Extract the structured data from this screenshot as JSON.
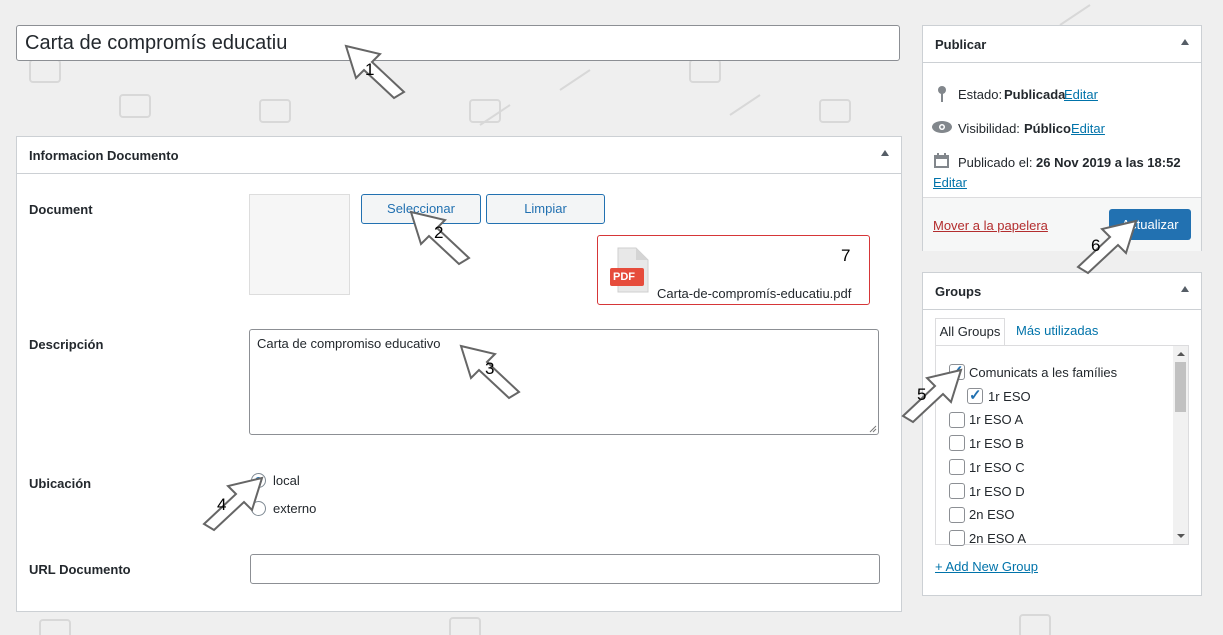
{
  "post_title": "Carta de compromís educatiu",
  "info_box": {
    "title": "Informacion Documento",
    "document_label": "Document",
    "select_button": "Seleccionar",
    "clear_button": "Limpiar",
    "file_badge": "PDF",
    "file_name": "Carta-de-compromís-educatiu.pdf",
    "description_label": "Descripción",
    "description_value": "Carta de compromiso educativo",
    "location_label": "Ubicación",
    "location_options": [
      "local",
      "externo"
    ],
    "location_selected": "local",
    "url_label": "URL Documento",
    "url_value": ""
  },
  "publish_box": {
    "title": "Publicar",
    "status_label": "Estado:",
    "status_value": "Publicada",
    "visibility_label": "Visibilidad:",
    "visibility_value": "Público",
    "published_label": "Publicado el:",
    "published_value": "26 Nov 2019 a las 18:52",
    "edit_link": "Editar",
    "trash_link": "Mover a la papelera",
    "update_button": "Actualizar"
  },
  "groups_box": {
    "title": "Groups",
    "tabs": [
      "All Groups",
      "Más utilizadas"
    ],
    "items": [
      {
        "label": "Comunicats a les famílies",
        "checked": true
      },
      {
        "label": "1r ESO",
        "checked": true
      },
      {
        "label": "1r ESO A",
        "checked": false
      },
      {
        "label": "1r ESO B",
        "checked": false
      },
      {
        "label": "1r ESO C",
        "checked": false
      },
      {
        "label": "1r ESO D",
        "checked": false
      },
      {
        "label": "2n ESO",
        "checked": false
      },
      {
        "label": "2n ESO A",
        "checked": false
      }
    ],
    "add_link": "+ Add New Group"
  },
  "annotations": [
    "1",
    "2",
    "3",
    "4",
    "5",
    "6",
    "7"
  ],
  "colors": {
    "accent": "#2271b1",
    "pdf_red": "#e64c3c",
    "highlight_border": "#d63638"
  }
}
